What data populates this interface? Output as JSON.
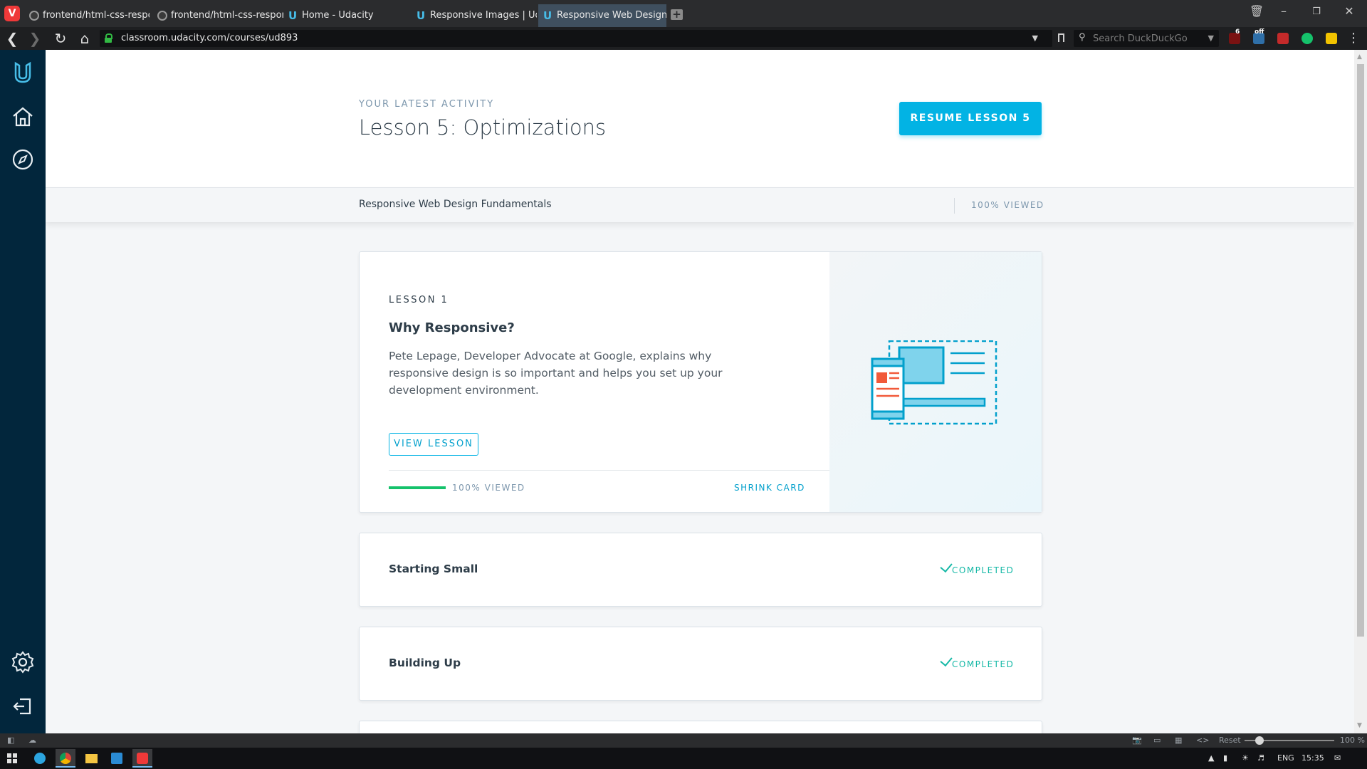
{
  "browser": {
    "tabs": [
      {
        "title": "frontend/html-css-responsiv",
        "icon": "github-icon"
      },
      {
        "title": "frontend/html-css-responsiv",
        "icon": "github-icon"
      },
      {
        "title": "Home - Udacity",
        "icon": "udacity-icon"
      },
      {
        "title": "Responsive Images | Udacity",
        "icon": "udacity-icon"
      },
      {
        "title": "Responsive Web Design Fun",
        "icon": "udacity-icon",
        "active": true
      }
    ],
    "url": "classroom.udacity.com/courses/ud893",
    "search_placeholder": "Search DuckDuckGo",
    "extensions": [
      {
        "name": "ublock-icon",
        "badge": "6"
      },
      {
        "name": "extension-off-icon",
        "badge": "off"
      },
      {
        "name": "lastpass-icon"
      },
      {
        "name": "grammarly-icon"
      },
      {
        "name": "keep-icon"
      }
    ]
  },
  "rail": {
    "items": [
      "udacity-logo",
      "home-icon",
      "explore-icon",
      "settings-icon",
      "logout-icon"
    ]
  },
  "activity": {
    "kicker": "YOUR LATEST ACTIVITY",
    "title": "Lesson 5: Optimizations",
    "resume_label": "RESUME LESSON 5"
  },
  "course": {
    "name": "Responsive Web Design Fundamentals",
    "viewed": "100% VIEWED"
  },
  "lesson_card": {
    "kicker": "LESSON 1",
    "title": "Why Responsive?",
    "description": "Pete Lepage, Developer Advocate at Google, explains why responsive design is so important and helps you set up your development environment.",
    "view_label": "VIEW LESSON",
    "progress": 1.0,
    "progress_label": "100% VIEWED",
    "shrink_label": "SHRINK CARD"
  },
  "lessons": [
    {
      "title": "Starting Small",
      "status": "COMPLETED"
    },
    {
      "title": "Building Up",
      "status": "COMPLETED"
    }
  ],
  "statusbar": {
    "reset_label": "Reset",
    "zoom": "100 %"
  },
  "taskbar": {
    "language": "ENG",
    "time": "15:35"
  },
  "colors": {
    "accent": "#02b3e4",
    "rail": "#02263c",
    "completed": "#15b8a6",
    "progress": "#15c26b"
  }
}
